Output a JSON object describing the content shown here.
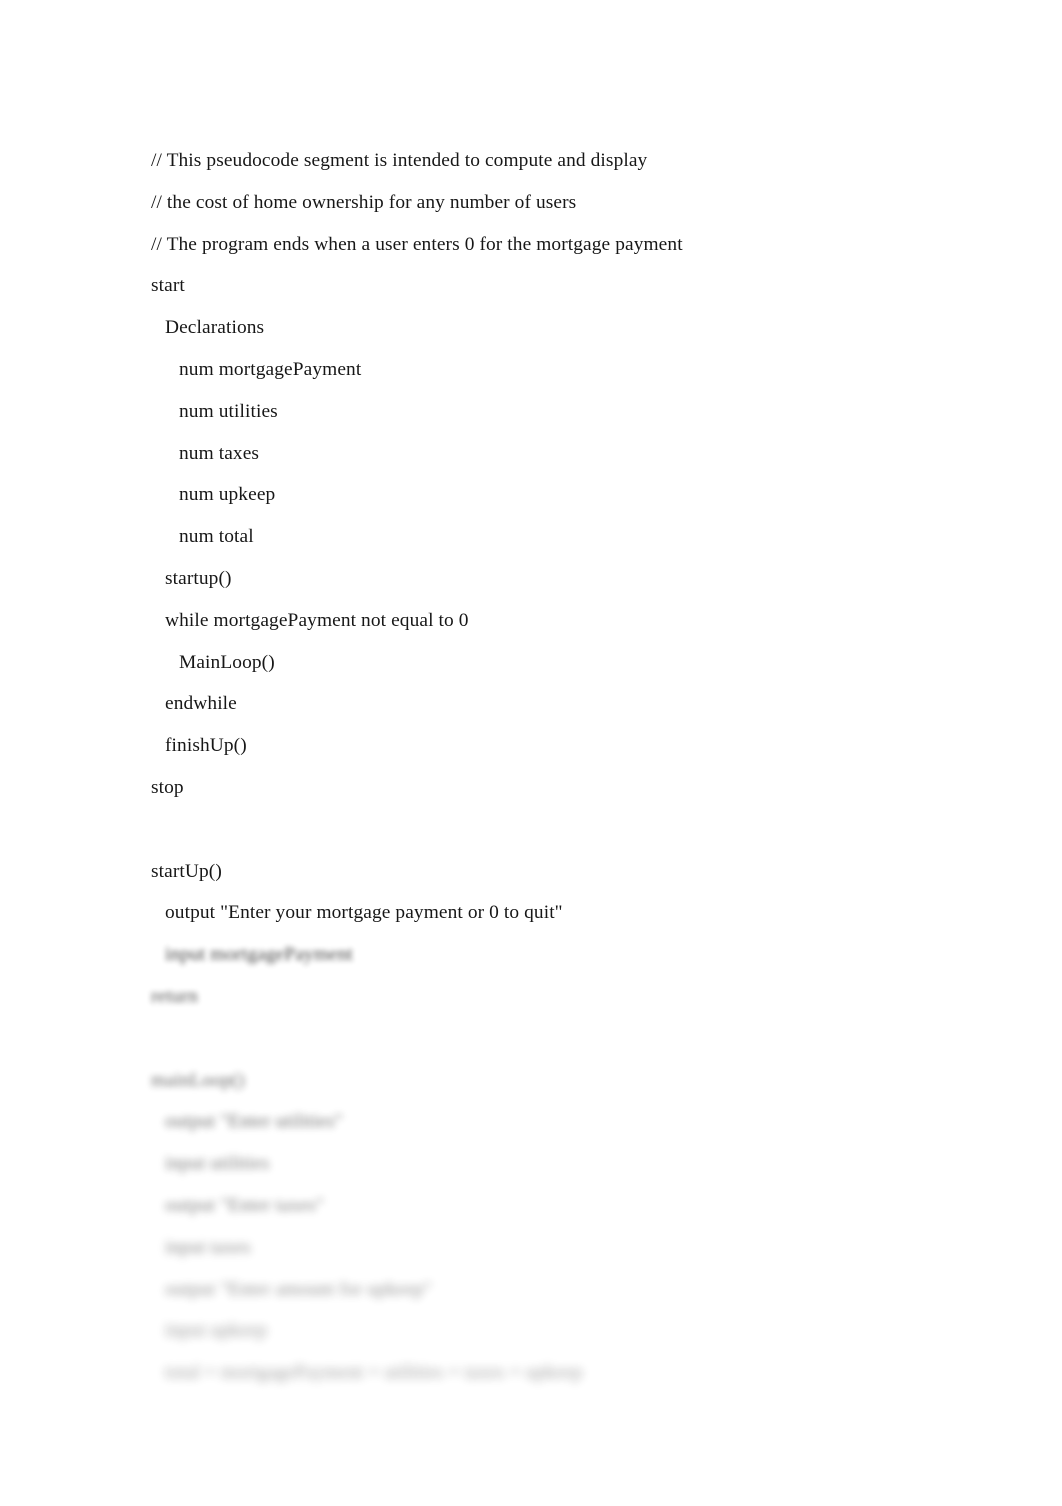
{
  "document": {
    "background_color": "#ffffff",
    "text_color": "#171717",
    "lines": [
      {
        "text": "// This pseudocode segment is intended to compute and display",
        "indent": 0,
        "blur": 0
      },
      {
        "text": "// the cost of home ownership for any number of users",
        "indent": 0,
        "blur": 0
      },
      {
        "text": "// The program ends when a user enters 0 for the mortgage payment",
        "indent": 0,
        "blur": 0
      },
      {
        "text": "start",
        "indent": 0,
        "blur": 0
      },
      {
        "text": "Declarations",
        "indent": 1,
        "blur": 0
      },
      {
        "text": "num mortgagePayment",
        "indent": 2,
        "blur": 0
      },
      {
        "text": "num utilities",
        "indent": 2,
        "blur": 0
      },
      {
        "text": "num taxes",
        "indent": 2,
        "blur": 0
      },
      {
        "text": "num upkeep",
        "indent": 2,
        "blur": 0
      },
      {
        "text": "num total",
        "indent": 2,
        "blur": 0
      },
      {
        "text": "startup()",
        "indent": 1,
        "blur": 0
      },
      {
        "text": "while mortgagePayment not equal to 0",
        "indent": 1,
        "blur": 0
      },
      {
        "text": "MainLoop()",
        "indent": 2,
        "blur": 0
      },
      {
        "text": "endwhile",
        "indent": 1,
        "blur": 0
      },
      {
        "text": "finishUp()",
        "indent": 1,
        "blur": 0
      },
      {
        "text": "stop",
        "indent": 0,
        "blur": 0
      },
      {
        "text": " ",
        "indent": 0,
        "blur": 0
      },
      {
        "text": "startUp()",
        "indent": 0,
        "blur": 0
      },
      {
        "text": "output \"Enter your mortgage payment or 0 to quit\"",
        "indent": 1,
        "blur": 0
      },
      {
        "text": "input mortgagePayment",
        "indent": 1,
        "blur": 1
      },
      {
        "text": "return",
        "indent": 0,
        "blur": 2
      },
      {
        "text": " ",
        "indent": 0,
        "blur": 3
      },
      {
        "text": "mainLoop()",
        "indent": 0,
        "blur": 4
      },
      {
        "text": "output \"Enter utilities\"",
        "indent": 1,
        "blur": 5
      },
      {
        "text": "input utilities",
        "indent": 1,
        "blur": 6
      },
      {
        "text": "output \"Enter taxes\"",
        "indent": 1,
        "blur": 7
      },
      {
        "text": "input taxes",
        "indent": 1,
        "blur": 8
      },
      {
        "text": "output \"Enter amount for upkeep\"",
        "indent": 1,
        "blur": 9
      },
      {
        "text": "input upkeep",
        "indent": 1,
        "blur": 10
      },
      {
        "text": "total = mortgagePayment + utilities + taxes + upkeep",
        "indent": 1,
        "blur": 11
      }
    ]
  }
}
